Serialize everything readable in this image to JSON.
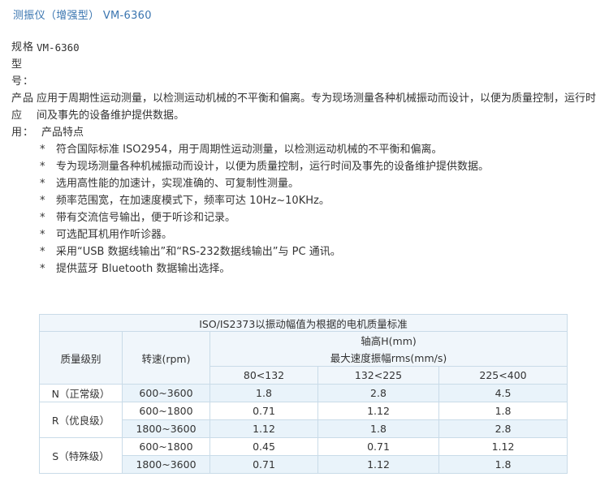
{
  "page_title": "测振仪（增强型） VM-6360",
  "spec": {
    "model_label": "规格型号：",
    "model_value": "VM-6360",
    "usage_label": "产品应用：",
    "usage_text": "应用于周期性运动测量，以检测运动机械的不平衡和偏离。专为现场测量各种机械振动而设计，以便为质量控制，运行时间及事先的设备维护提供数据。",
    "features_title": "产品特点",
    "bullet": "*",
    "features": [
      "符合国际标准 ISO2954，用于周期性运动测量，以检测运动机械的不平衡和偏离。",
      "专为现场测量各种机械振动而设计，以便为质量控制，运行时间及事先的设备维护提供数据。",
      "选用高性能的加速计，实现准确的、可复制性测量。",
      "频率范围宽，在加速度模式下，频率可达 10Hz~10KHz。",
      "带有交流信号输出，便于听诊和记录。",
      "可选配耳机用作听诊器。",
      "采用“USB 数据线输出”和“RS-232数据线输出”与 PC 通讯。",
      "提供蓝牙 Bluetooth 数据输出选择。"
    ]
  },
  "table": {
    "caption": "ISO/IS2373以振动幅值为根据的电机质量标准",
    "col_grade": "质量级别",
    "col_speed": "转速(rpm)",
    "axis_height": "轴高H(mm)",
    "max_velocity": "最大速度振幅rms(mm/s)",
    "ranges": [
      "80<132",
      "132<225",
      "225<400"
    ],
    "groups": [
      {
        "grade": "N（正常级）",
        "rows": [
          {
            "speed": "600~3600",
            "values": [
              "1.8",
              "2.8",
              "4.5"
            ]
          }
        ]
      },
      {
        "grade": "R（优良级）",
        "rows": [
          {
            "speed": "600~1800",
            "values": [
              "0.71",
              "1.12",
              "1.8"
            ]
          },
          {
            "speed": "1800~3600",
            "values": [
              "1.12",
              "1.8",
              "2.8"
            ]
          }
        ]
      },
      {
        "grade": "S（特殊级）",
        "rows": [
          {
            "speed": "600~1800",
            "values": [
              "0.45",
              "0.71",
              "1.12"
            ]
          },
          {
            "speed": "1800~3600",
            "values": [
              "0.71",
              "1.12",
              "1.8"
            ]
          }
        ]
      }
    ]
  }
}
